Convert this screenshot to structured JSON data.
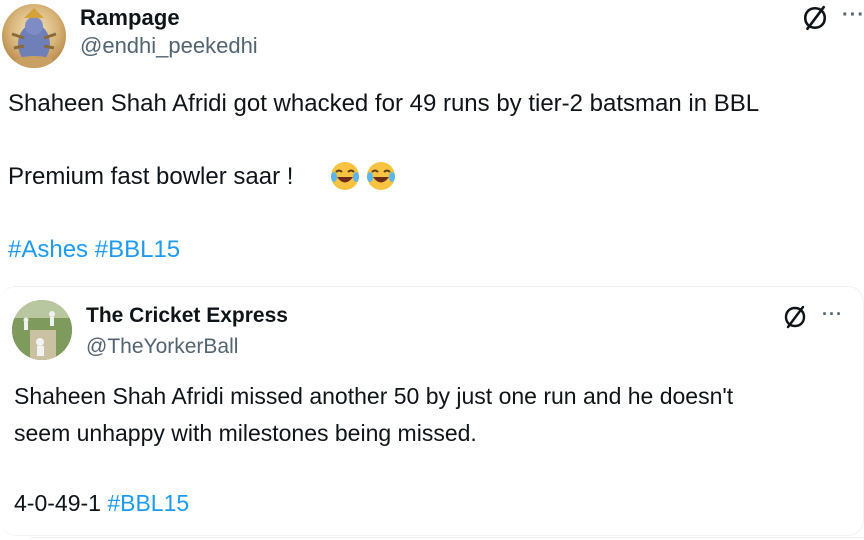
{
  "post": {
    "author_name": "Rampage",
    "author_handle": "@endhi_peekedhi",
    "more_glyph": "···",
    "text_line1": "Shaheen Shah Afridi got whacked for 49 runs by tier-2 batsman in BBL",
    "text_line2": "Premium fast bowler saar !",
    "emojis": "😂😂",
    "hashtags": [
      "#Ashes",
      "#BBL15"
    ]
  },
  "quote": {
    "author_name": "The Cricket Express",
    "author_handle": "@TheYorkerBall",
    "more_glyph": "···",
    "text_line1": "Shaheen Shah Afridi missed another 50 by just one run and he doesn't",
    "text_line2": "seem unhappy with milestones being missed.",
    "stats_text": "4-0-49-1",
    "hashtag": "#BBL15"
  },
  "colors": {
    "text": "#0f1419",
    "secondary": "#536471",
    "link": "#1d9bf0",
    "border": "#eff3f4"
  },
  "icons": [
    "grok-icon",
    "more-options-icon",
    "laughing-emoji-icon"
  ]
}
